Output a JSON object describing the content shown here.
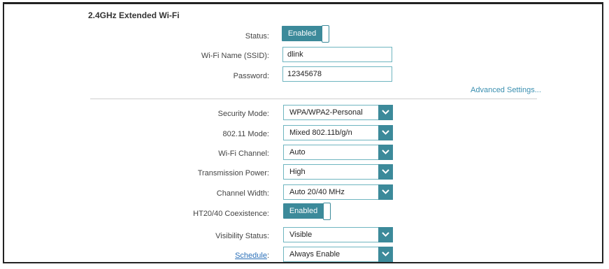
{
  "section": {
    "title": "2.4GHz Extended Wi-Fi"
  },
  "status": {
    "label": "Status:",
    "value": "Enabled"
  },
  "ssid": {
    "label": "Wi-Fi Name (SSID):",
    "value": "dlink"
  },
  "password": {
    "label": "Password:",
    "value": "12345678"
  },
  "advanced_link": "Advanced Settings...",
  "security_mode": {
    "label": "Security Mode:",
    "value": "WPA/WPA2-Personal"
  },
  "mode_80211": {
    "label": "802.11 Mode:",
    "value": "Mixed 802.11b/g/n"
  },
  "wifi_channel": {
    "label": "Wi-Fi Channel:",
    "value": "Auto"
  },
  "tx_power": {
    "label": "Transmission Power:",
    "value": "High"
  },
  "channel_width": {
    "label": "Channel Width:",
    "value": "Auto 20/40 MHz"
  },
  "ht_coexistence": {
    "label": "HT20/40 Coexistence:",
    "value": "Enabled"
  },
  "visibility": {
    "label": "Visibility Status:",
    "value": "Visible"
  },
  "schedule": {
    "label": "Schedule",
    "label_suffix": ":",
    "value": "Always Enable"
  },
  "colors": {
    "accent": "#3c8a9a",
    "input_border": "#6fb5c0",
    "link": "#3a8fb0"
  },
  "icons": {
    "dropdown": "chevron-down-icon"
  }
}
